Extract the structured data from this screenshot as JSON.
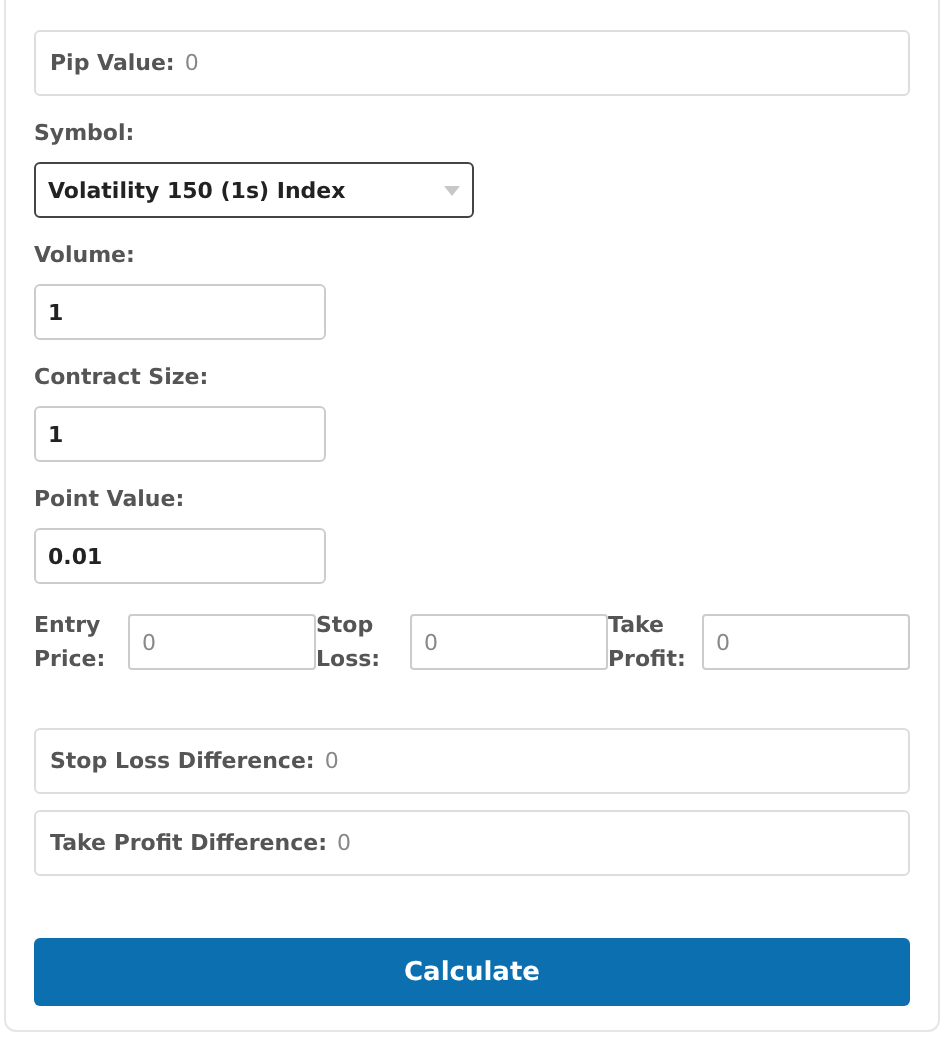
{
  "pip_value": {
    "label": "Pip Value:",
    "value": "0"
  },
  "symbol": {
    "label": "Symbol:",
    "value": "Volatility 150 (1s) Index"
  },
  "fields": [
    {
      "label": "Volume:",
      "value": "1"
    },
    {
      "label": "Contract Size:",
      "value": "1"
    },
    {
      "label": "Point Value:",
      "value": "0.01"
    }
  ],
  "prices": [
    {
      "label_lines": [
        "Entry",
        "Price:"
      ],
      "placeholder": "0"
    },
    {
      "label_lines": [
        "Stop",
        "Loss:"
      ],
      "placeholder": "0"
    },
    {
      "label_lines": [
        "Take",
        "Profit:"
      ],
      "placeholder": "0"
    }
  ],
  "results": [
    {
      "label": "Stop Loss Difference:",
      "value": "0"
    },
    {
      "label": "Take Profit Difference:",
      "value": "0"
    }
  ],
  "button": "Calculate"
}
